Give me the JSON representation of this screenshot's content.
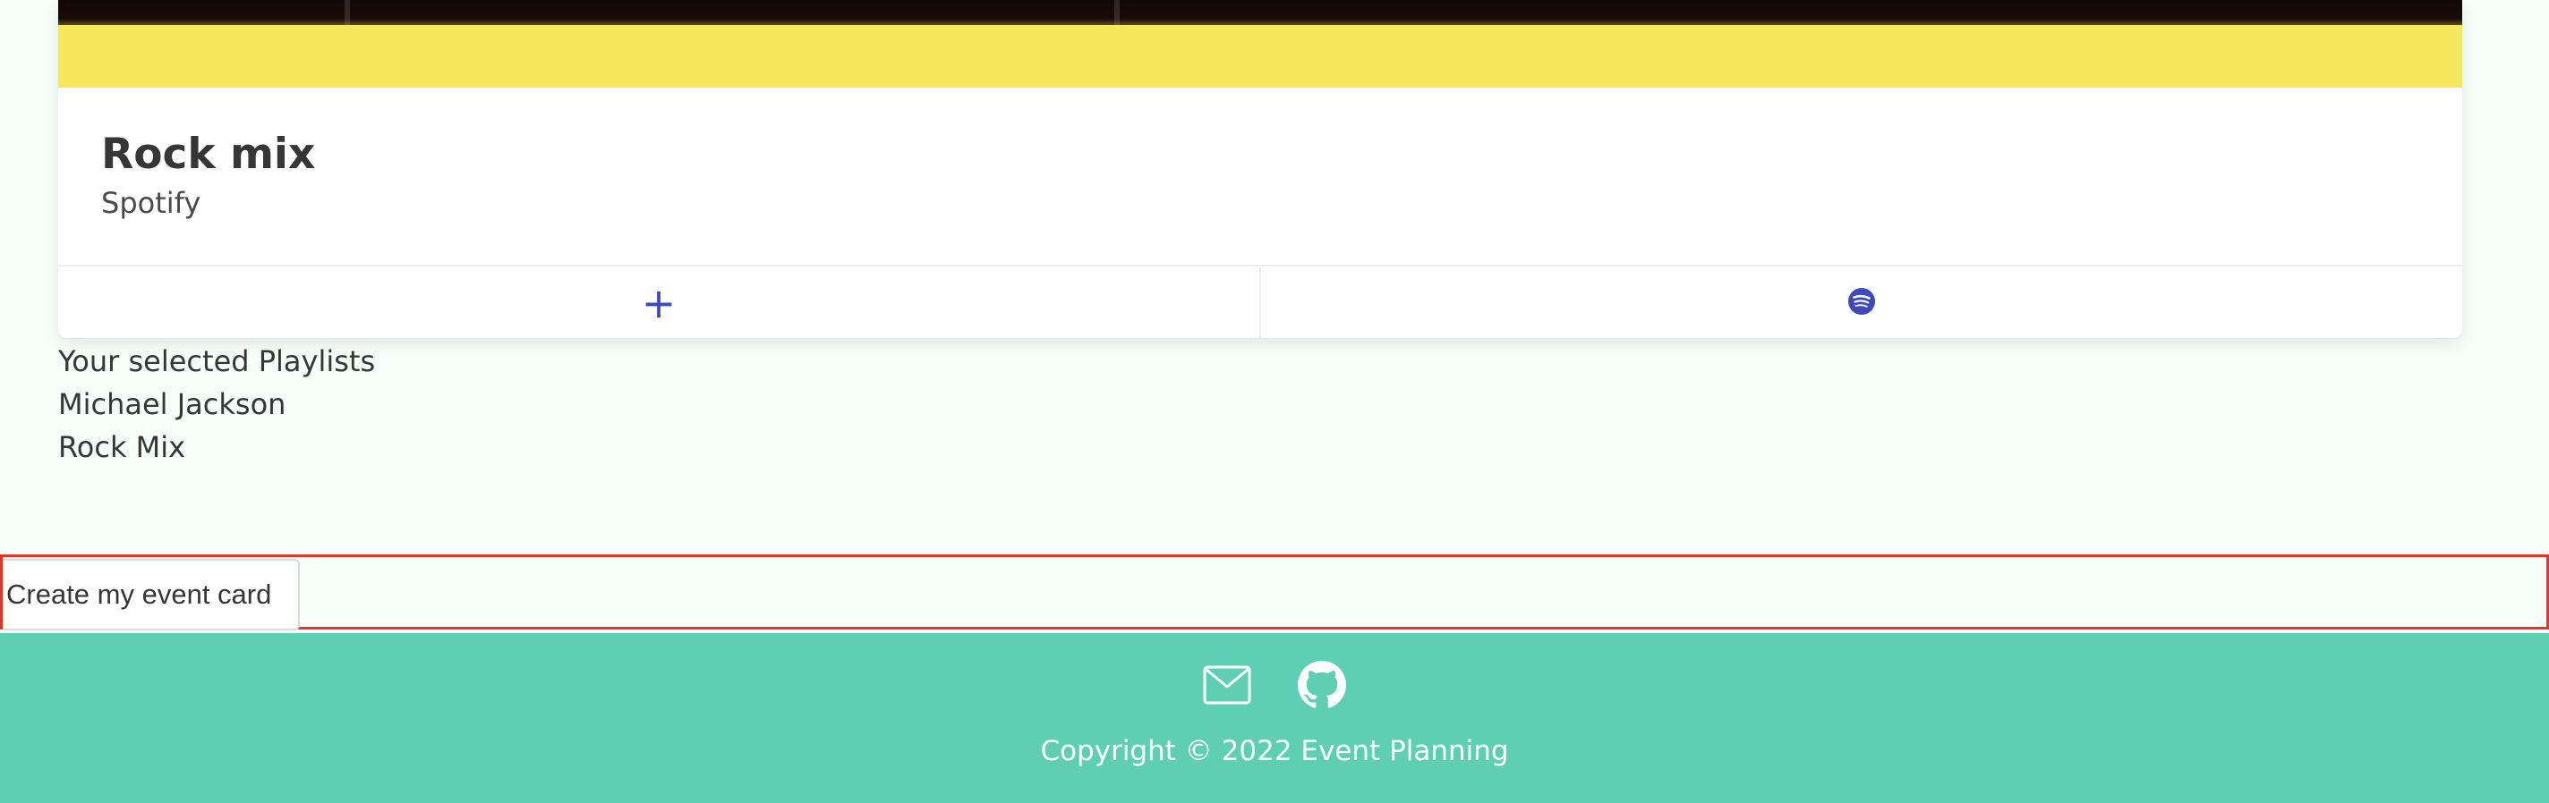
{
  "card": {
    "title": "Rock mix",
    "subtitle": "Spotify",
    "add_icon": "plus-icon",
    "spotify_icon": "spotify-icon",
    "image_colors": {
      "band": "#f6e65b",
      "top": "#120808"
    },
    "accent": "#3e4ab8"
  },
  "selected": {
    "heading": "Your selected Playlists",
    "items": [
      "Michael Jackson",
      "Rock Mix"
    ]
  },
  "create": {
    "button_label": "Create my event card",
    "border_color": "#e0342c"
  },
  "footer": {
    "background": "#5fcfb3",
    "icons": [
      "mail-icon",
      "github-icon"
    ],
    "copyright": "Copyright © 2022 Event Planning"
  }
}
